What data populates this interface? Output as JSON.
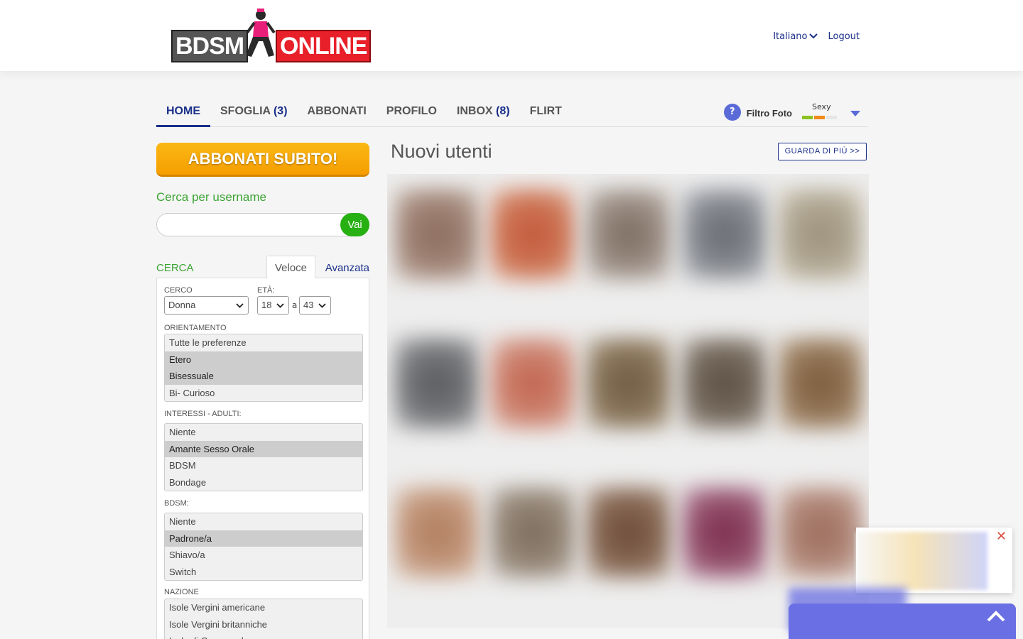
{
  "header": {
    "logo": {
      "left_text": "BDSM",
      "right_text": "ONLINE"
    },
    "language_label": "Italiano",
    "logout_label": "Logout"
  },
  "nav": {
    "items": [
      {
        "label": "HOME",
        "count": ""
      },
      {
        "label": "SFOGLIA",
        "count": "(3)"
      },
      {
        "label": "ABBONATI",
        "count": ""
      },
      {
        "label": "PROFILO",
        "count": ""
      },
      {
        "label": "INBOX",
        "count": "(8)"
      },
      {
        "label": "FLIRT",
        "count": ""
      }
    ],
    "photo_filter": {
      "icon": "?",
      "label": "Filtro Foto",
      "level_label": "Sexy",
      "level_colors": [
        "#8dc21f",
        "#f28a1a",
        "#e6e6e6"
      ]
    }
  },
  "sidebar": {
    "subscribe_button": "ABBONATI SUBITO!",
    "search_username_title": "Cerca per username",
    "search_input_value": "",
    "search_button": "Vai",
    "search_section": {
      "title": "CERCA",
      "tab_quick": "Veloce",
      "tab_advanced": "Avanzata",
      "seeking_label": "CERCO",
      "seeking_value": "Donna",
      "age_label": "ETÀ:",
      "age_from": "18",
      "age_to_sep": "a",
      "age_to": "43",
      "orientation_label": "ORIENTAMENTO",
      "orientation_options": [
        {
          "label": "Tutte le preferenze",
          "selected": false
        },
        {
          "label": "Etero",
          "selected": true
        },
        {
          "label": "Bisessuale",
          "selected": true
        },
        {
          "label": "Bi- Curioso",
          "selected": false
        }
      ],
      "interests_label": "INTERESSI - ADULTI:",
      "interests_options": [
        {
          "label": "Niente",
          "selected": false
        },
        {
          "label": "Amante Sesso Orale",
          "selected": true
        },
        {
          "label": "BDSM",
          "selected": false
        },
        {
          "label": "Bondage",
          "selected": false
        }
      ],
      "bdsm_label": "BDSM:",
      "bdsm_options": [
        {
          "label": "Niente",
          "selected": false
        },
        {
          "label": "Padrone/a",
          "selected": true
        },
        {
          "label": "Shiavo/a",
          "selected": false
        },
        {
          "label": "Switch",
          "selected": false
        }
      ],
      "nation_label": "NAZIONE",
      "nation_options": [
        {
          "label": "Isole Vergini americane",
          "selected": false
        },
        {
          "label": "Isole Vergini britanniche",
          "selected": false
        },
        {
          "label": "Isole di Capo verde",
          "selected": false
        }
      ]
    }
  },
  "main": {
    "title": "Nuovi utenti",
    "see_more_button": "GUARDA DI PIÙ >>"
  },
  "colors": {
    "brand_blue": "#1a2f8a",
    "accent_green": "#3aa431",
    "cta_orange": "#f59e00",
    "scroll_top_bg": "#6a6fe3"
  }
}
